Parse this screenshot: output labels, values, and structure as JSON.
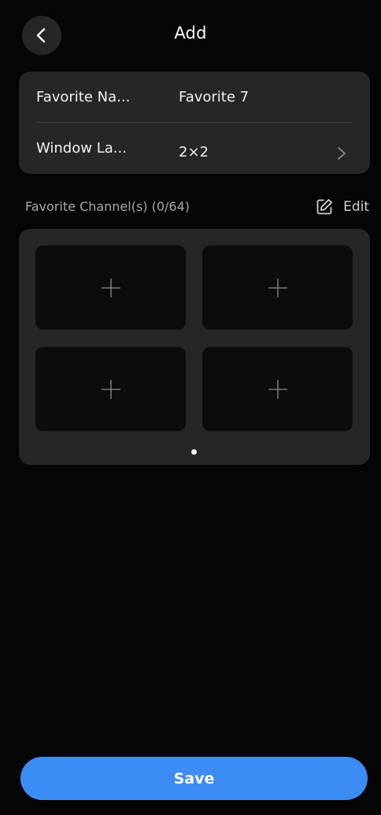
{
  "header": {
    "title": "Add",
    "back_icon": "chevron-left-icon"
  },
  "settings": {
    "rows": [
      {
        "label": "Favorite Na...",
        "value": "Favorite 7"
      },
      {
        "label": "Window La...",
        "value": "2×2",
        "icon": "chevron-right-icon"
      }
    ]
  },
  "channels": {
    "title": "Favorite Channel(s) (0/64)",
    "edit_label": "Edit",
    "edit_icon": "edit-icon",
    "slot_icon": "plus-icon",
    "slot_count": 4
  },
  "footer": {
    "save_label": "Save"
  },
  "colors": {
    "background": "#050505",
    "card": "#262626",
    "slot": "#0c0c0c",
    "accent": "#3b8cf4"
  }
}
